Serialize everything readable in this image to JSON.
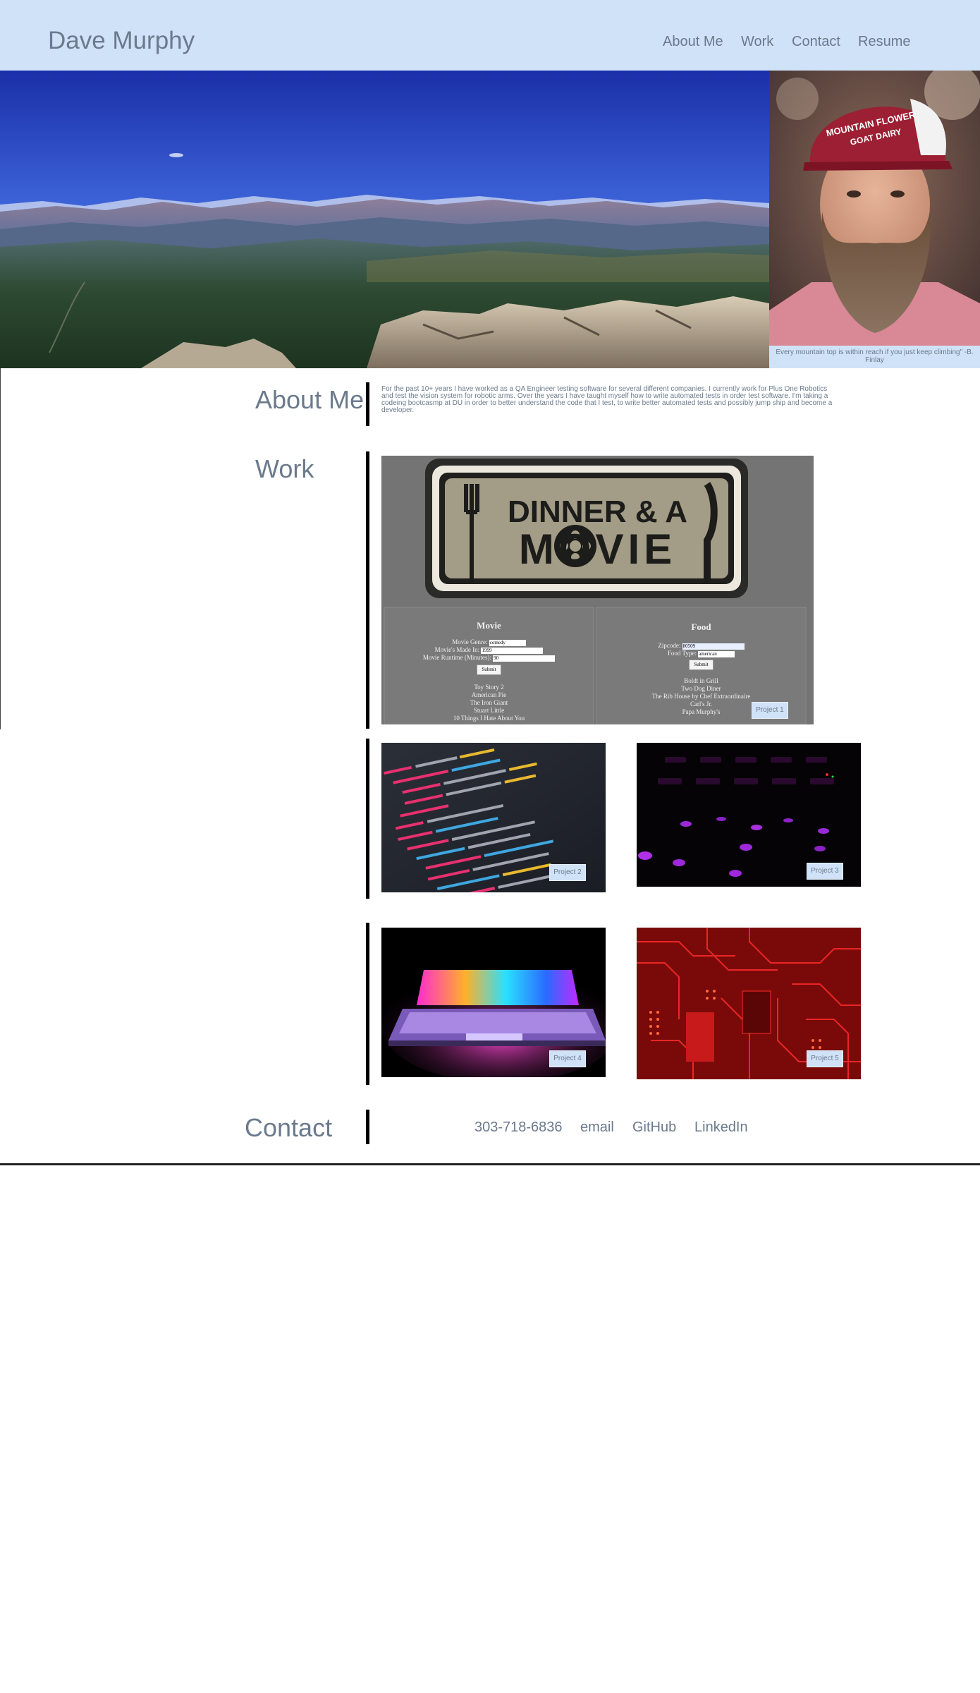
{
  "header": {
    "brand": "Dave Murphy",
    "nav": [
      "About Me",
      "Work",
      "Contact",
      "Resume"
    ]
  },
  "hero": {
    "quote": "Every mountain top is within reach if you just keep climbing\" -B. Finlay",
    "hat_text_line1": "MOUNTAIN FLOWER",
    "hat_text_line2": "GOAT DAIRY"
  },
  "about": {
    "title": "About Me",
    "text": "For the past 10+ years I have worked as a QA Engineer testing software for several different companies. I currently work for Plus One Robotics and test the vision system for robotic arms. Over the years I have taught myself how to write automated tests in order test software. I'm taking a codeing bootcasmp at DU in order to better understand the code that I test, to write better automated tests and possibly jump ship and become a developer."
  },
  "work": {
    "title": "Work",
    "project1": {
      "logo_line1": "DINNER & A",
      "logo_line2": "MOVIE",
      "label": "Project 1",
      "movie_panel": {
        "title": "Movie",
        "genre_label": "Movie Genre:",
        "genre_value": "comedy",
        "made_label": "Movie's Made In:",
        "made_value": "1999",
        "runtime_label": "Movie Runtime (Minutes):",
        "runtime_value": "90",
        "submit": "Submit",
        "results": [
          "Toy Story 2",
          "American Pie",
          "The Iron Giant",
          "Stuart Little",
          "10 Things I Hate About You"
        ]
      },
      "food_panel": {
        "title": "Food",
        "zip_label": "Zipcode:",
        "zip_value": "80509",
        "type_label": "Food Type:",
        "type_value": "american",
        "submit": "Submit",
        "results": [
          "Boldt in Grill",
          "Two Dog Diner",
          "The Rib House by Chef Extraordinaire",
          "Carl's Jr.",
          "Papa Murphy's"
        ]
      }
    },
    "project2": {
      "label": "Project 2"
    },
    "project3": {
      "label": "Project 3"
    },
    "project4": {
      "label": "Project 4"
    },
    "project5": {
      "label": "Project 5"
    }
  },
  "contact": {
    "title": "Contact",
    "links": [
      "303-718-6836",
      "email",
      "GitHub",
      "LinkedIn"
    ]
  },
  "colors": {
    "header_bg": "#cfe2f7",
    "text": "#6b7a8c",
    "bar": "#000000"
  }
}
